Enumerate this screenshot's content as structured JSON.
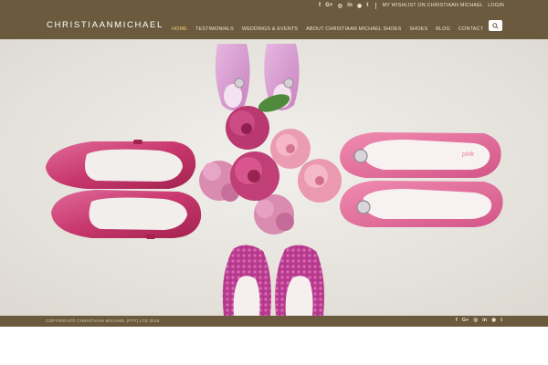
{
  "brand": {
    "logo": "CHRISTIAANMICHAEL"
  },
  "topbar": {
    "social": [
      "f",
      "G+",
      "◎",
      "in",
      "◉",
      "t"
    ],
    "wishlist": "MY WISHLIST ON CHRISTIAAN MICHAEL",
    "login": "LOGIN"
  },
  "nav": [
    "HOME",
    "TESTIMONIALS",
    "WEDDINGS & EVENTS",
    "ABOUT CHRISTIAAN MICHAEL SHOES",
    "SHOES",
    "BLOG",
    "CONTACT"
  ],
  "hero": {
    "shoe_brand_label": "pink"
  },
  "footer": {
    "copyright": "COPYRIGHT© CHRISTIAAN MICHAEL (PTY) LTD 2015",
    "social": [
      "f",
      "G+",
      "◎",
      "in",
      "◉",
      "t"
    ]
  },
  "colors": {
    "header": "#6b5a3e",
    "active_nav": "#f3d27a",
    "hero_bg": "#eae7e1"
  }
}
